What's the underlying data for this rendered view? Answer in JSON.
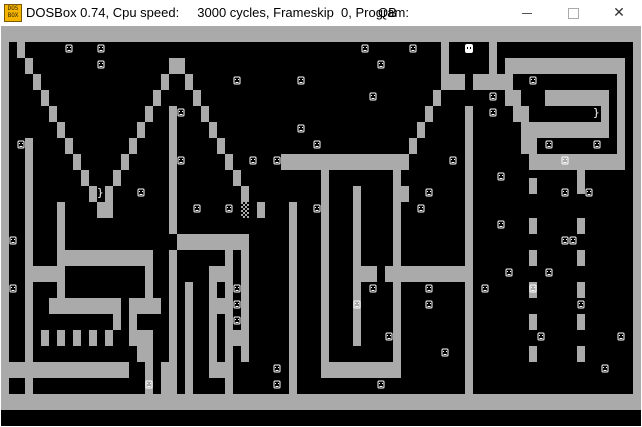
{
  "window": {
    "icon_label": "DOS BOX",
    "title": "DOSBox 0.74, Cpu speed:     3000 cycles, Frameskip  0, Program:",
    "program": "QB",
    "controls": {
      "minimize": "–",
      "maximize": "□",
      "close": "✕"
    }
  },
  "game": {
    "colors": {
      "background": "#000000",
      "wall": "#aaaaaa",
      "smiley": "#ffffff",
      "player": "#ffffff"
    },
    "icons": {
      "collectible": "smiley-face-icon",
      "player": "player-smiley-icon",
      "marker": "brace-marker-icon"
    }
  }
}
